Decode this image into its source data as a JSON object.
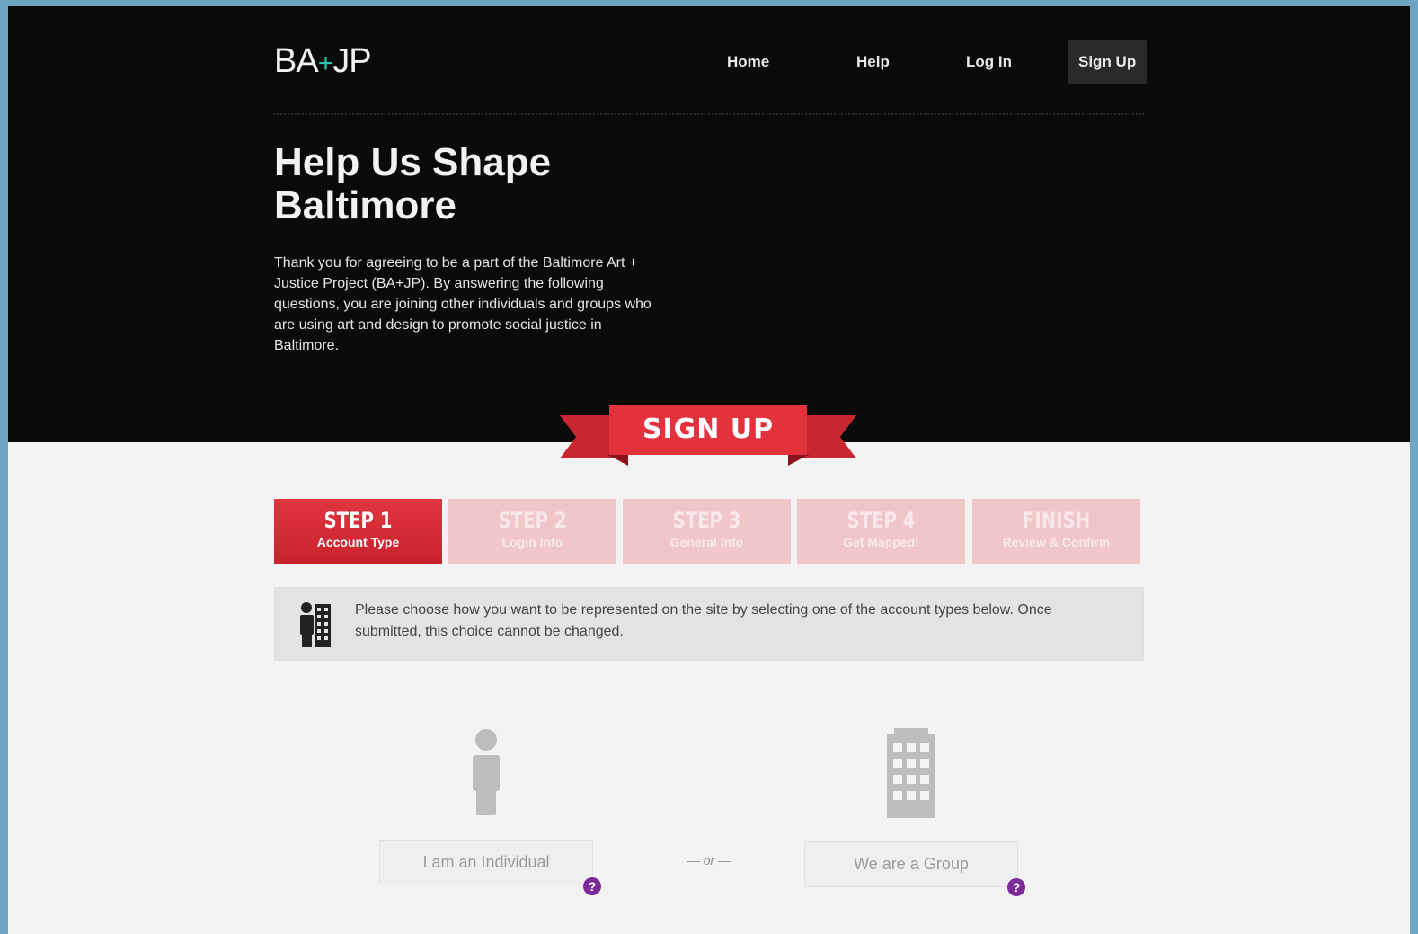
{
  "brand": {
    "logo_left": "BA",
    "logo_plus": "+",
    "logo_right": "JP",
    "accent": "#2fc4b0"
  },
  "nav": {
    "home": "Home",
    "help": "Help",
    "login": "Log In",
    "signup": "Sign Up"
  },
  "hero": {
    "headline_line1": "Help Us Shape",
    "headline_line2": "Baltimore",
    "intro": "Thank you for agreeing to be a part of the Baltimore Art + Justice Project (BA+JP). By answering the following questions, you are joining other individuals and groups who are using art and design to promote social justice in Baltimore."
  },
  "ribbon": {
    "label": "SIGN UP",
    "color": "#e03540"
  },
  "steps": [
    {
      "title": "STEP 1",
      "subtitle": "Account Type",
      "state": "active"
    },
    {
      "title": "STEP 2",
      "subtitle": "Login Info",
      "state": "inactive"
    },
    {
      "title": "STEP 3",
      "subtitle": "General Info",
      "state": "inactive"
    },
    {
      "title": "STEP 4",
      "subtitle": "Get Mapped!",
      "state": "inactive"
    },
    {
      "title": "FINISH",
      "subtitle": "Review & Confirm",
      "state": "inactive"
    }
  ],
  "info": {
    "icon": "person-building-icon",
    "message": "Please choose how you want to be represented on the site by selecting one of the account types below. Once submitted, this choice cannot be changed."
  },
  "choices": {
    "individual": {
      "label": "I am an Individual",
      "icon": "person-icon",
      "help": "?"
    },
    "separator": "— or —",
    "group": {
      "label": "We are a Group",
      "icon": "building-icon",
      "help": "?"
    }
  }
}
